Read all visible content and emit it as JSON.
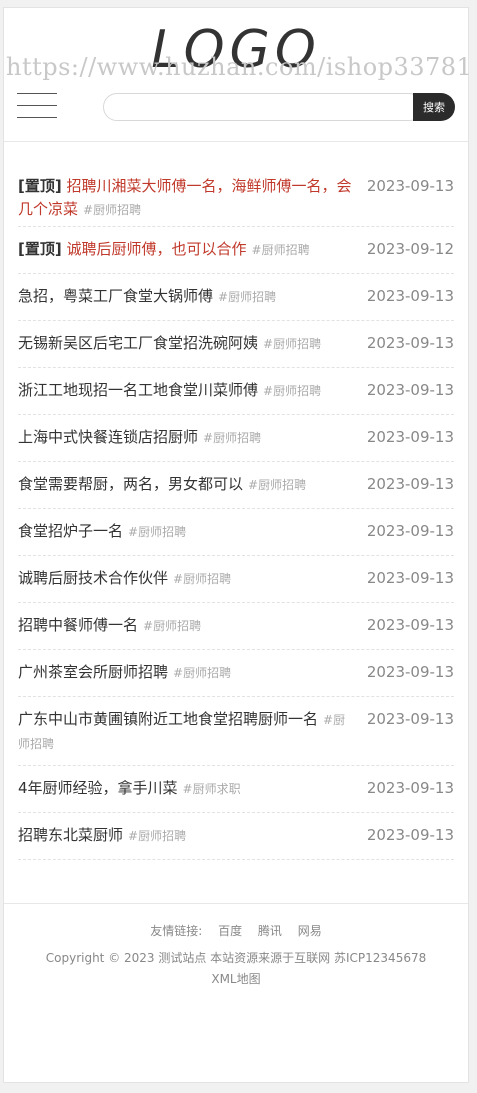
{
  "header": {
    "logo": "LOGO",
    "watermark": "https://www.huzhan.com/ishop33781",
    "search_placeholder": "",
    "search_button": "搜索"
  },
  "items": [
    {
      "pin": "[置顶]",
      "title": "招聘川湘菜大师傅一名，海鲜师傅一名，会几个凉菜",
      "tag": "#厨师招聘",
      "date": "2023-09-13",
      "top": true
    },
    {
      "pin": "[置顶]",
      "title": "诚聘后厨师傅，也可以合作",
      "tag": "#厨师招聘",
      "date": "2023-09-12",
      "top": true
    },
    {
      "title": "急招，粤菜工厂食堂大锅师傅",
      "tag": "#厨师招聘",
      "date": "2023-09-13"
    },
    {
      "title": "无锡新吴区后宅工厂食堂招洗碗阿姨",
      "tag": "#厨师招聘",
      "date": "2023-09-13"
    },
    {
      "title": "浙江工地现招一名工地食堂川菜师傅",
      "tag": "#厨师招聘",
      "date": "2023-09-13"
    },
    {
      "title": "上海中式快餐连锁店招厨师",
      "tag": "#厨师招聘",
      "date": "2023-09-13"
    },
    {
      "title": "食堂需要帮厨，两名，男女都可以",
      "tag": "#厨师招聘",
      "date": "2023-09-13"
    },
    {
      "title": "食堂招炉子一名",
      "tag": "#厨师招聘",
      "date": "2023-09-13"
    },
    {
      "title": "诚聘后厨技术合作伙伴",
      "tag": "#厨师招聘",
      "date": "2023-09-13"
    },
    {
      "title": "招聘中餐师傅一名",
      "tag": "#厨师招聘",
      "date": "2023-09-13"
    },
    {
      "title": "广州茶室会所厨师招聘",
      "tag": "#厨师招聘",
      "date": "2023-09-13"
    },
    {
      "title": "广东中山市黄圃镇附近工地食堂招聘厨师一名",
      "tag": "#厨师招聘",
      "date": "2023-09-13"
    },
    {
      "title": "4年厨师经验，拿手川菜",
      "tag": "#厨师求职",
      "date": "2023-09-13"
    },
    {
      "title": "招聘东北菜厨师",
      "tag": "#厨师招聘",
      "date": "2023-09-13"
    }
  ],
  "footer": {
    "links_label": "友情链接:",
    "links": [
      "百度",
      "腾讯",
      "网易"
    ],
    "copyright": "Copyright © 2023 测试站点 本站资源来源于互联网 苏ICP12345678",
    "sitemap": "XML地图"
  }
}
